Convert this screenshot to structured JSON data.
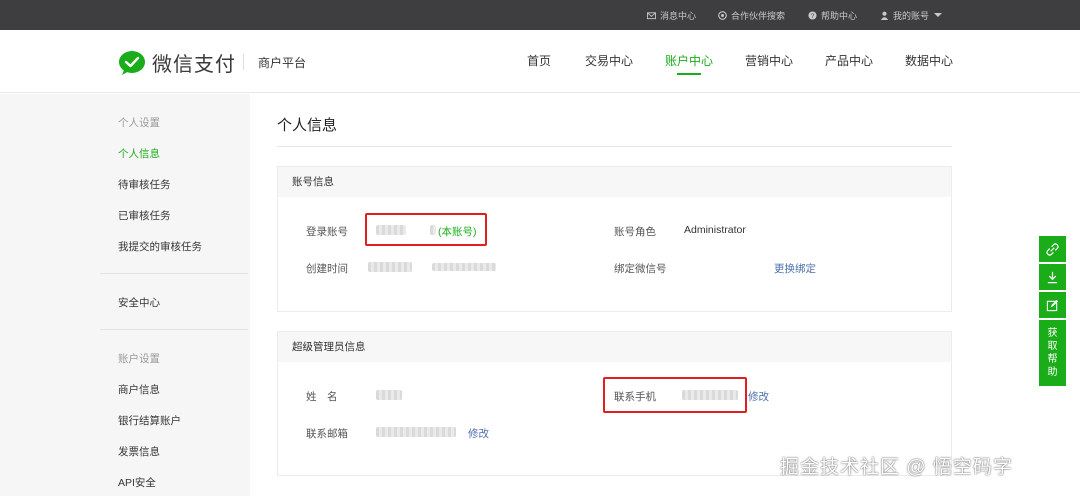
{
  "topbar": {
    "messages": "消息中心",
    "partner_search": "合作伙伴搜索",
    "help_center": "帮助中心",
    "my_account": "我的账号"
  },
  "header": {
    "brand": "微信支付",
    "platform": "商户平台",
    "nav": [
      "首页",
      "交易中心",
      "账户中心",
      "营销中心",
      "产品中心",
      "数据中心"
    ],
    "active_nav": "账户中心"
  },
  "sidebar": {
    "section_personal": "个人设置",
    "personal_info": "个人信息",
    "pending_review": "待审核任务",
    "reviewed": "已审核任务",
    "my_submitted": "我提交的审核任务",
    "security_center": "安全中心",
    "section_account": "账户设置",
    "merchant_info": "商户信息",
    "bank_account": "银行结算账户",
    "invoice_info": "发票信息",
    "api_security": "API安全"
  },
  "main": {
    "title": "个人信息",
    "account_panel": {
      "heading": "账号信息",
      "login_account_label": "登录账号",
      "this_account_tag": "(本账号)",
      "role_label": "账号角色",
      "role_value": "Administrator",
      "created_label": "创建时间",
      "wechat_label": "绑定微信号",
      "rebind_link": "更换绑定"
    },
    "admin_panel": {
      "heading": "超级管理员信息",
      "name_label": "姓　名",
      "phone_label": "联系手机",
      "phone_edit": "修改",
      "email_label": "联系邮箱",
      "email_edit": "修改"
    }
  },
  "float_tools": {
    "help_text": "获取帮助"
  },
  "watermark": "掘金技术社区 @ 悟空码字",
  "colors": {
    "accent": "#1aad19",
    "topbar": "#3e3e40",
    "link": "#4d6fad",
    "highlight": "#e02020"
  }
}
